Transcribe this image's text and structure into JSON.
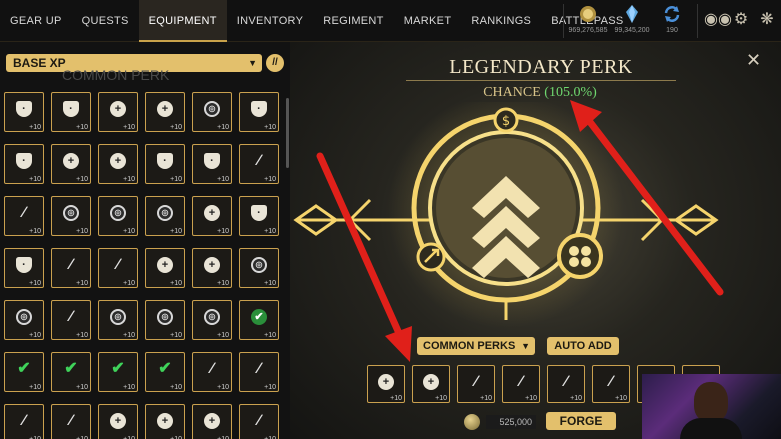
{
  "nav": {
    "items": [
      "GEAR UP",
      "QUESTS",
      "EQUIPMENT",
      "INVENTORY",
      "REGIMENT",
      "MARKET",
      "RANKINGS",
      "BATTLEPASS"
    ],
    "active": "EQUIPMENT"
  },
  "currencies": [
    {
      "icon": "gold-coin-icon",
      "value": "969,276,585"
    },
    {
      "icon": "crystal-icon",
      "value": "99,345,200"
    },
    {
      "icon": "refresh-icon",
      "value": "190"
    }
  ],
  "top_icons": [
    "friends-icon",
    "settings-gear-icon",
    "options-icon"
  ],
  "left_panel": {
    "filter_label": "BASE XP",
    "ghost_header": "COMMON PERK",
    "level_tag": "+10",
    "grid": [
      [
        "shield",
        "shield",
        "plus",
        "plus",
        "ring",
        "shield"
      ],
      [
        "shield",
        "plus",
        "plus",
        "shield",
        "shield",
        "wrench"
      ],
      [
        "wrench",
        "ring",
        "ring",
        "ring",
        "plus",
        "shield"
      ],
      [
        "shield",
        "wrench",
        "wrench",
        "plus",
        "plus",
        "ring"
      ],
      [
        "ring",
        "wrench",
        "ring",
        "ring",
        "ring",
        "check"
      ],
      [
        "check",
        "check",
        "check",
        "check",
        "wrench",
        "wrench"
      ],
      [
        "wrench",
        "wrench",
        "plus",
        "plus",
        "plus",
        "wrench"
      ]
    ]
  },
  "forge_panel": {
    "title": "LEGENDARY PERK",
    "chance_label": "CHANCE",
    "chance_value": "(105.0%)",
    "perk_type_dropdown": "COMMON PERKS",
    "auto_add_label": "AUTO ADD",
    "slots": [
      "plus",
      "plus",
      "wrench",
      "wrench",
      "wrench",
      "wrench",
      "empty",
      "empty"
    ],
    "level_tag": "+10",
    "cost": "525,000",
    "forge_label": "FORGE"
  },
  "colors": {
    "accent_gold": "#e3c06c",
    "border_gold": "#caa14f",
    "arrow_red": "#e0201a",
    "chance_green": "#6fd86f"
  }
}
